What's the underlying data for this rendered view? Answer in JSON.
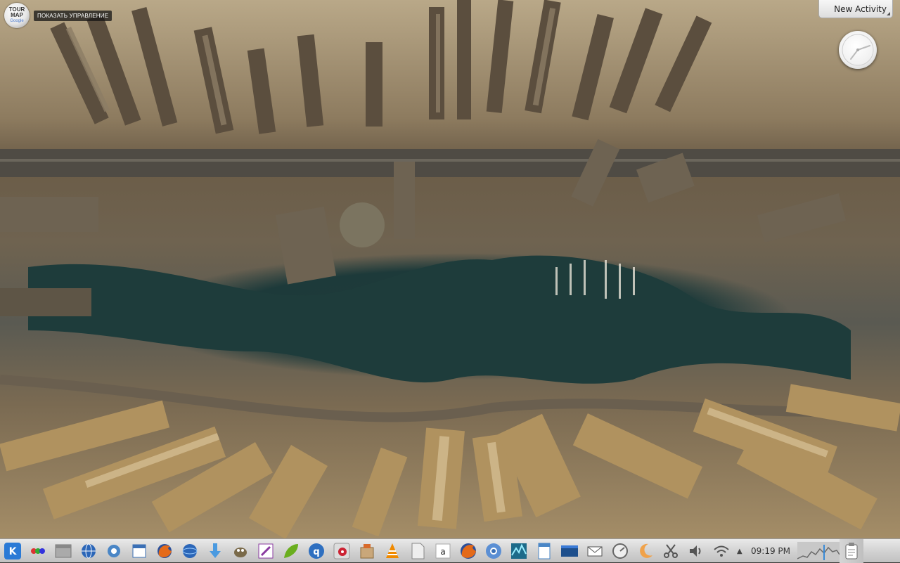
{
  "overlay": {
    "tourmap": {
      "logo_line1": "TOUR",
      "logo_line2": "MAP",
      "logo_line3": "Google",
      "controls_label": "ПОКАЗАТЬ УПРАВЛЕНИЕ"
    }
  },
  "desktop": {
    "activity_button_label": "New Activity",
    "clock_widget_icon": "analog-clock-icon"
  },
  "taskbar": {
    "clock": {
      "time": "09:19 PM"
    },
    "launchers": [
      {
        "name": "kde-menu-icon",
        "color": "#2a7ad6"
      },
      {
        "name": "activities-icon",
        "color": "#d33"
      },
      {
        "name": "show-desktop-icon",
        "color": "#888"
      },
      {
        "name": "globe-icon",
        "color": "#2b66b8"
      },
      {
        "name": "browser-settings-icon",
        "color": "#4a86c6"
      },
      {
        "name": "calendar-icon",
        "color": "#3a6fb5"
      },
      {
        "name": "firefox-icon",
        "color": "#e46a1a"
      },
      {
        "name": "network-globe-icon",
        "color": "#2b66b8"
      },
      {
        "name": "download-arrow-icon",
        "color": "#4a9ae0"
      },
      {
        "name": "gimp-icon",
        "color": "#7a6a4a"
      },
      {
        "name": "text-editor-icon",
        "color": "#8a3aa0"
      },
      {
        "name": "leaf-app-icon",
        "color": "#6aae1e"
      },
      {
        "name": "qbittorrent-icon",
        "color": "#2e6fc0"
      },
      {
        "name": "system-settings-icon",
        "color": "#c23"
      },
      {
        "name": "package-manager-icon",
        "color": "#d86a2a"
      },
      {
        "name": "vlc-icon",
        "color": "#f08a00"
      },
      {
        "name": "document-icon",
        "color": "#eee"
      },
      {
        "name": "amazon-icon",
        "color": "#222"
      },
      {
        "name": "firefox-running-icon",
        "color": "#e46a1a"
      },
      {
        "name": "chromium-icon",
        "color": "#5b8fd4"
      },
      {
        "name": "system-monitor-icon",
        "color": "#1d6b8a"
      },
      {
        "name": "kwrite-icon",
        "color": "#4a86c6"
      },
      {
        "name": "desktop-window-icon",
        "color": "#1e4f8c"
      },
      {
        "name": "mail-icon",
        "color": "#555"
      },
      {
        "name": "speedometer-icon",
        "color": "#666"
      },
      {
        "name": "weather-moon-icon",
        "color": "#f0a24a"
      },
      {
        "name": "scissors-icon",
        "color": "#555"
      },
      {
        "name": "volume-icon",
        "color": "#555"
      },
      {
        "name": "wifi-icon",
        "color": "#555"
      }
    ],
    "tray_expand_icon": "chevron-up-icon",
    "system_monitor_icon": "cpu-graph-icon",
    "end_icon": "clipboard-icon"
  }
}
